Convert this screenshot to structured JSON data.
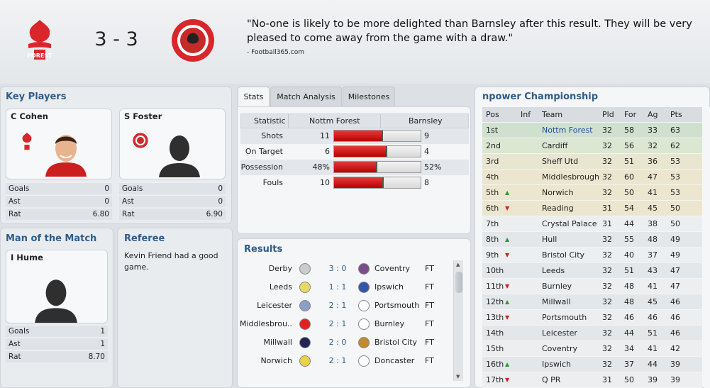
{
  "match": {
    "score": "3 - 3",
    "quote": "\"No-one is likely to be more delighted than Barnsley after this result. They will be very pleased to come away from the game with a draw.\"",
    "quote_source": "- Football365.com",
    "home_crest": "nottingham-forest-crest-icon",
    "away_crest": "barnsley-crest-icon"
  },
  "key_players": {
    "title": "Key Players",
    "players": [
      {
        "name": "C Cohen",
        "goals_label": "Goals",
        "goals": "0",
        "ast_label": "Ast",
        "ast": "0",
        "rat_label": "Rat",
        "rat": "6.80"
      },
      {
        "name": "S Foster",
        "goals_label": "Goals",
        "goals": "0",
        "ast_label": "Ast",
        "ast": "0",
        "rat_label": "Rat",
        "rat": "6.90"
      }
    ]
  },
  "motm": {
    "title": "Man of the Match",
    "name": "I Hume",
    "goals_label": "Goals",
    "goals": "1",
    "ast_label": "Ast",
    "ast": "1",
    "rat_label": "Rat",
    "rat": "8.70"
  },
  "referee": {
    "title": "Referee",
    "text": "Kevin Friend had a good game."
  },
  "tabs": [
    "Stats",
    "Match Analysis",
    "Milestones"
  ],
  "stats": {
    "headers": [
      "Statistic",
      "Nottm Forest",
      "Barnsley"
    ],
    "rows": [
      {
        "label": "Shots",
        "home": "11",
        "away": "9",
        "home_share": 0.55
      },
      {
        "label": "On Target",
        "home": "6",
        "away": "4",
        "home_share": 0.6
      },
      {
        "label": "Possession",
        "home": "48%",
        "away": "52%",
        "home_share": 0.48
      },
      {
        "label": "Fouls",
        "home": "10",
        "away": "8",
        "home_share": 0.56
      }
    ]
  },
  "results": {
    "title": "Results",
    "rows": [
      {
        "home": "Derby",
        "score": "3 : 0",
        "away": "Coventry",
        "status": "FT"
      },
      {
        "home": "Leeds",
        "score": "1 : 1",
        "away": "Ipswich",
        "status": "FT"
      },
      {
        "home": "Leicester",
        "score": "2 : 1",
        "away": "Portsmouth",
        "status": "FT"
      },
      {
        "home": "Middlesbrou..",
        "score": "2 : 1",
        "away": "Burnley",
        "status": "FT"
      },
      {
        "home": "Millwall",
        "score": "2 : 0",
        "away": "Bristol City",
        "status": "FT"
      },
      {
        "home": "Norwich",
        "score": "2 : 1",
        "away": "Doncaster",
        "status": "FT"
      }
    ]
  },
  "league": {
    "title": "npower Championship",
    "headers": [
      "Pos",
      "Inf",
      "Team",
      "Pld",
      "For",
      "Ag",
      "Pts"
    ],
    "rows": [
      {
        "pos": "1st",
        "inf": "",
        "team": "Nottm Forest",
        "pld": "32",
        "for": "58",
        "ag": "33",
        "pts": "63",
        "zone": "#cfe0cf",
        "highlight": true
      },
      {
        "pos": "2nd",
        "inf": "",
        "team": "Cardiff",
        "pld": "32",
        "for": "56",
        "ag": "32",
        "pts": "62",
        "zone": "#dbe6d3"
      },
      {
        "pos": "3rd",
        "inf": "",
        "team": "Sheff Utd",
        "pld": "32",
        "for": "51",
        "ag": "36",
        "pts": "53",
        "zone": "#e8e6cf"
      },
      {
        "pos": "4th",
        "inf": "",
        "team": "Middlesbrough",
        "pld": "32",
        "for": "60",
        "ag": "47",
        "pts": "53",
        "zone": "#ece6cf"
      },
      {
        "pos": "5th",
        "inf": "up",
        "team": "Norwich",
        "pld": "32",
        "for": "50",
        "ag": "41",
        "pts": "53",
        "zone": "#ece6cf"
      },
      {
        "pos": "6th",
        "inf": "down",
        "team": "Reading",
        "pld": "31",
        "for": "54",
        "ag": "45",
        "pts": "50",
        "zone": "#ece6cf"
      },
      {
        "pos": "7th",
        "inf": "",
        "team": "Crystal Palace",
        "pld": "31",
        "for": "44",
        "ag": "38",
        "pts": "50",
        "zone": ""
      },
      {
        "pos": "8th",
        "inf": "up",
        "team": "Hull",
        "pld": "32",
        "for": "55",
        "ag": "48",
        "pts": "49",
        "zone": ""
      },
      {
        "pos": "9th",
        "inf": "down",
        "team": "Bristol City",
        "pld": "32",
        "for": "40",
        "ag": "37",
        "pts": "49",
        "zone": ""
      },
      {
        "pos": "10th",
        "inf": "",
        "team": "Leeds",
        "pld": "32",
        "for": "51",
        "ag": "43",
        "pts": "47",
        "zone": ""
      },
      {
        "pos": "11th",
        "inf": "down",
        "team": "Burnley",
        "pld": "32",
        "for": "48",
        "ag": "41",
        "pts": "47",
        "zone": ""
      },
      {
        "pos": "12th",
        "inf": "up",
        "team": "Millwall",
        "pld": "32",
        "for": "48",
        "ag": "45",
        "pts": "46",
        "zone": ""
      },
      {
        "pos": "13th",
        "inf": "down",
        "team": "Portsmouth",
        "pld": "32",
        "for": "46",
        "ag": "46",
        "pts": "46",
        "zone": ""
      },
      {
        "pos": "14th",
        "inf": "",
        "team": "Leicester",
        "pld": "32",
        "for": "44",
        "ag": "51",
        "pts": "46",
        "zone": ""
      },
      {
        "pos": "15th",
        "inf": "",
        "team": "Coventry",
        "pld": "32",
        "for": "34",
        "ag": "41",
        "pts": "42",
        "zone": ""
      },
      {
        "pos": "16th",
        "inf": "up",
        "team": "Ipswich",
        "pld": "32",
        "for": "37",
        "ag": "44",
        "pts": "39",
        "zone": ""
      },
      {
        "pos": "17th",
        "inf": "down",
        "team": "Q PR",
        "pld": "31",
        "for": "50",
        "ag": "39",
        "pts": "39",
        "zone": ""
      }
    ]
  },
  "colors": {
    "accent": "#2f5d8a",
    "bar_fill": "#c00000",
    "link": "#1f4f9a"
  }
}
